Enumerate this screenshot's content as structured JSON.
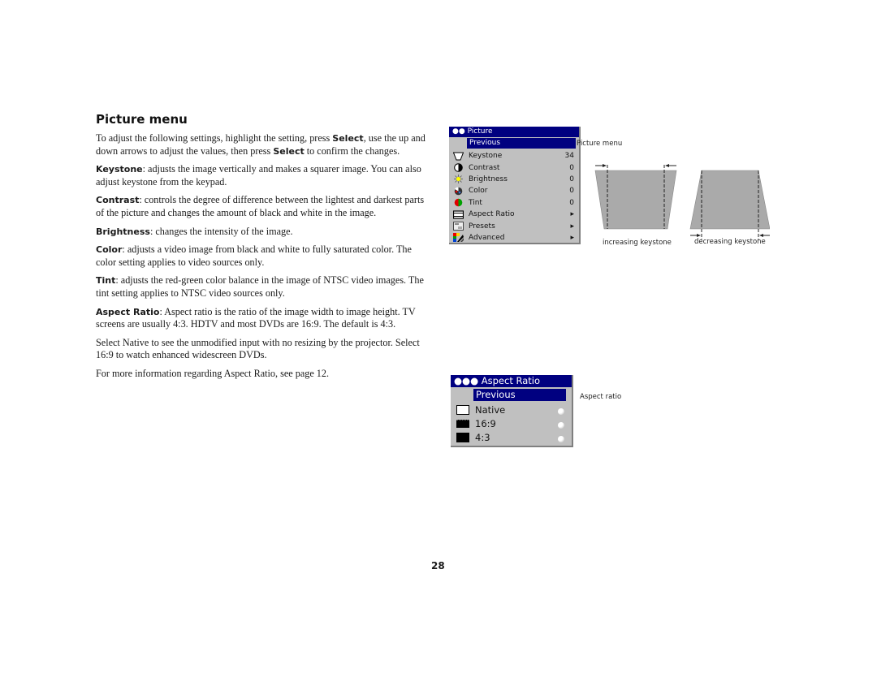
{
  "section": {
    "title": "Picture menu",
    "paragraphs": [
      {
        "lead": "",
        "text": "To adjust the following settings, highlight the setting, press Select, use the up and down arrows to adjust the values, then press Select to confirm the changes."
      },
      {
        "lead": "Keystone",
        "text": ": adjusts the image vertically and makes a squarer image. You can also adjust keystone from the keypad."
      },
      {
        "lead": "Contrast",
        "text": ": controls the degree of difference between the lightest and darkest parts of the picture and changes the amount of black and white in the image."
      },
      {
        "lead": "Brightness",
        "text": ": changes the intensity of the image."
      },
      {
        "lead": "Color",
        "text": ": adjusts a video image from black and white to fully saturated color. The color setting applies to video sources only."
      },
      {
        "lead": "Tint",
        "text": ": adjusts the red-green color balance in the image of NTSC video images. The tint setting applies to NTSC video sources only."
      },
      {
        "lead": "Aspect Ratio",
        "text": ": Aspect ratio is the ratio of the image width to image height. TV screens are usually 4:3. HDTV and most DVDs are 16:9. The default is 4:3."
      },
      {
        "lead": "",
        "text": "Select Native to see the unmodified input with no resizing by the projector. Select 16:9 to watch enhanced widescreen DVDs."
      },
      {
        "lead": "",
        "text": "For more information regarding Aspect Ratio, see page 12."
      }
    ],
    "intro_parts": [
      "To adjust the following settings, highlight the setting, press ",
      "Select",
      ", use the up and down arrows to adjust the values, then press ",
      "Select",
      " to confirm the changes."
    ]
  },
  "picture_menu": {
    "header": "●● Picture",
    "previous": "Previous",
    "items": [
      {
        "label": "Keystone",
        "value": "34",
        "icon": "keystone-icon"
      },
      {
        "label": "Contrast",
        "value": "0",
        "icon": "contrast-icon"
      },
      {
        "label": "Brightness",
        "value": "0",
        "icon": "brightness-icon"
      },
      {
        "label": "Color",
        "value": "0",
        "icon": "color-icon"
      },
      {
        "label": "Tint",
        "value": "0",
        "icon": "tint-icon"
      },
      {
        "label": "Aspect Ratio",
        "value": "▸",
        "icon": "aspect-ratio-icon"
      },
      {
        "label": "Presets",
        "value": "▸",
        "icon": "presets-icon"
      },
      {
        "label": "Advanced",
        "value": "▸",
        "icon": "advanced-icon"
      }
    ],
    "caption": "Picture menu"
  },
  "keystone_diagram": {
    "increasing_label": "increasing keystone",
    "decreasing_label": "decreasing keystone"
  },
  "aspect_menu": {
    "header": "●●● Aspect Ratio",
    "previous": "Previous",
    "options": [
      {
        "label": "Native"
      },
      {
        "label": "16:9"
      },
      {
        "label": "4:3"
      }
    ],
    "caption": "Aspect ratio"
  },
  "page_number": "28",
  "colors": {
    "menu_bg": "#c0c0c0",
    "menu_header": "#000080"
  }
}
